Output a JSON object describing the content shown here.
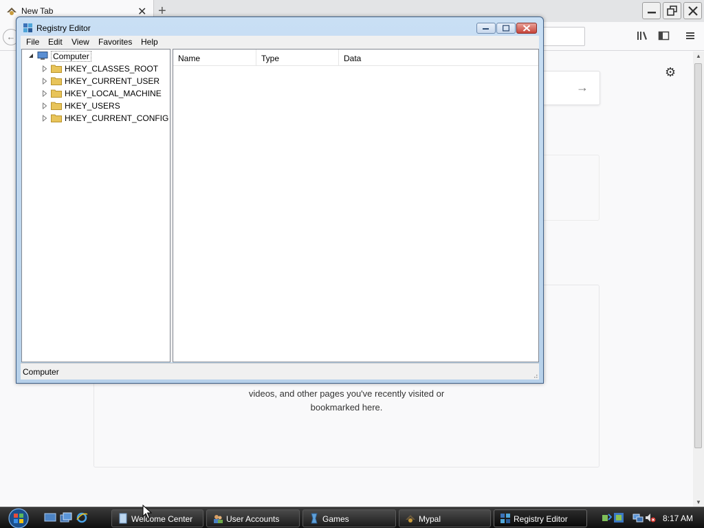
{
  "browser": {
    "tab": {
      "title": "New Tab"
    },
    "content": {
      "card_text_line1": "videos, and other pages you've recently visited or",
      "card_text_line2": "bookmarked here."
    }
  },
  "regedit": {
    "title": "Registry Editor",
    "menu": [
      "File",
      "Edit",
      "View",
      "Favorites",
      "Help"
    ],
    "tree": {
      "root": "Computer",
      "keys": [
        "HKEY_CLASSES_ROOT",
        "HKEY_CURRENT_USER",
        "HKEY_LOCAL_MACHINE",
        "HKEY_USERS",
        "HKEY_CURRENT_CONFIG"
      ]
    },
    "columns": [
      "Name",
      "Type",
      "Data"
    ],
    "status": "Computer"
  },
  "taskbar": {
    "tasks": [
      {
        "label": "Welcome Center",
        "icon": "welcome-center-icon"
      },
      {
        "label": "User Accounts",
        "icon": "user-accounts-icon"
      },
      {
        "label": "Games",
        "icon": "games-icon"
      },
      {
        "label": "Mypal",
        "icon": "mypal-icon"
      },
      {
        "label": "Registry Editor",
        "icon": "registry-editor-icon",
        "active": true
      }
    ],
    "clock": "8:17 AM"
  },
  "colors": {
    "accent": "#3e5e86",
    "close": "#c6443a",
    "folder": "#e8c45a"
  }
}
